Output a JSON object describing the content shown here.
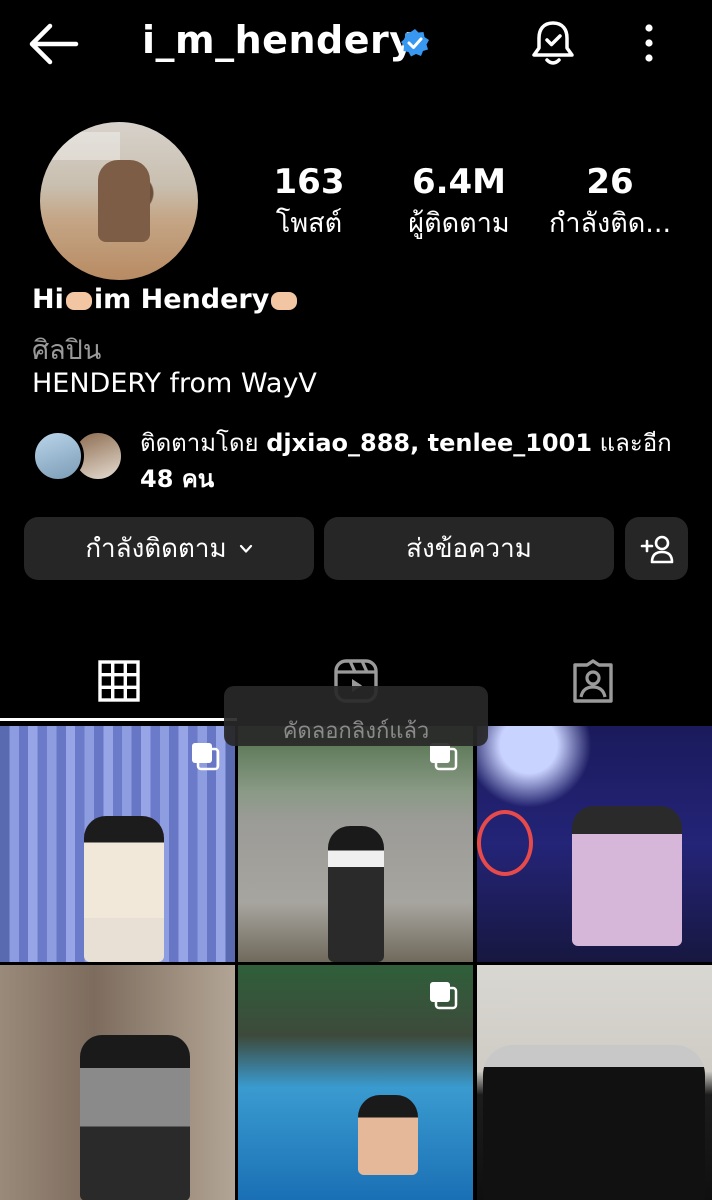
{
  "header": {
    "username": "i_m_hendery",
    "back_icon": "arrow-left-icon",
    "verified_icon": "verified-badge-icon",
    "verified_color": "#3897f0",
    "bell_icon": "bell-icon",
    "more_icon": "more-vertical-icon"
  },
  "profile": {
    "avatar_icon": "profile-photo",
    "stats": [
      {
        "value": "163",
        "label": "โพสต์"
      },
      {
        "value": "6.4M",
        "label": "ผู้ติดตาม"
      },
      {
        "value": "26",
        "label": "กำลังติด..."
      }
    ],
    "bio": {
      "name_part1": "Hi",
      "name_part2": "im Hendery",
      "category": "ศิลปิน",
      "text": "HENDERY from WayV"
    },
    "mutual": {
      "prefix": "ติดตามโดย",
      "users": "djxiao_888, tenlee_1001",
      "suffix": "และอีก",
      "count": "48 คน"
    }
  },
  "actions": {
    "following_label": "กำลังติดตาม",
    "message_label": "ส่งข้อความ",
    "add_icon": "add-person-icon"
  },
  "tabs": [
    {
      "icon": "grid-icon",
      "selected": true
    },
    {
      "icon": "reels-icon",
      "selected": false
    },
    {
      "icon": "tagged-icon",
      "selected": false
    }
  ],
  "toast": {
    "text": "คัดลอกลิงก์แล้ว"
  },
  "posts": [
    {
      "multi": true
    },
    {
      "multi": true
    },
    {
      "multi": false
    },
    {
      "multi": false
    },
    {
      "multi": true
    },
    {
      "multi": false
    }
  ]
}
